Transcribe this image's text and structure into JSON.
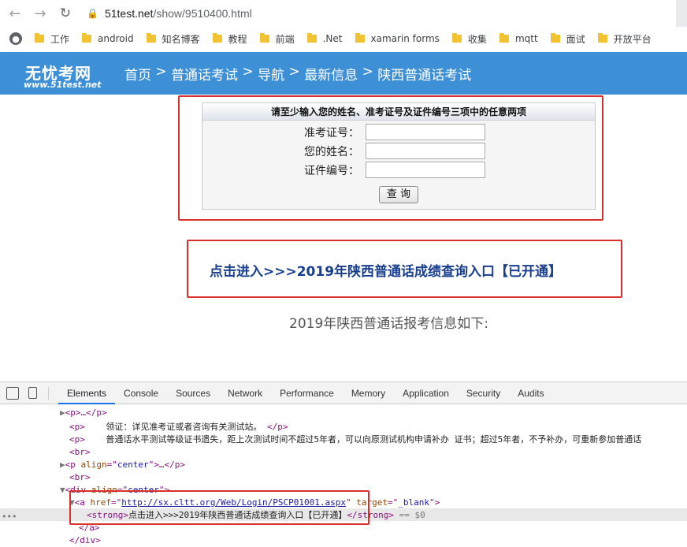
{
  "browser": {
    "url_domain": "51test.net",
    "url_path": "/show/9510400.html",
    "bookmarks": [
      "工作",
      "android",
      "知名博客",
      "教程",
      "前端",
      ".Net",
      "xamarin forms",
      "收集",
      "mqtt",
      "面试",
      "开放平台"
    ]
  },
  "site": {
    "logo_cn": "无忧考网",
    "logo_url": "www.51test.net",
    "breadcrumb": [
      "首页",
      "普通话考试",
      "导航",
      "最新信息",
      "陕西普通话考试"
    ],
    "breadcrumb_sep": " > "
  },
  "form": {
    "heading": "请至少输入您的姓名、准考证号及证件编号三项中的任意两项",
    "fields": [
      {
        "label": "准考证号：",
        "value": ""
      },
      {
        "label": "您的姓名：",
        "value": ""
      },
      {
        "label": "证件编号：",
        "value": ""
      }
    ],
    "submit": "查 询"
  },
  "entry_link": "点击进入>>>2019年陕西普通话成绩查询入口【已开通】",
  "info_title": "2019年陕西普通话报考信息如下:",
  "devtools": {
    "tabs": [
      "Elements",
      "Console",
      "Sources",
      "Network",
      "Performance",
      "Memory",
      "Application",
      "Security",
      "Audits"
    ],
    "active_tab": "Elements",
    "lines": {
      "l0": "<p>…</p>",
      "l1_text": "领证：详见准考证或者咨询有关测试站。",
      "l2_text": "普通话水平测试等级证书遗失，距上次测试时间不超过5年者，可以向原测试机构申请补办 证书；超过5年者，不予补办，可重新参加普通话",
      "l_br": "<br>",
      "p_align": "center",
      "div_align": "center",
      "a_href": "http://sx.cltt.org/Web/Login/PSCP01001.aspx",
      "a_target": "_blank",
      "strong_text": "点击进入>>>2019年陕西普通话成绩查询入口【已开通】",
      "dollar": "== $0"
    }
  }
}
